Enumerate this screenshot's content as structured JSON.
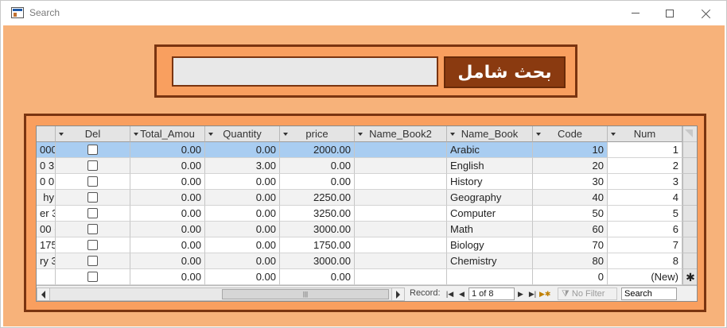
{
  "window": {
    "title": "Search"
  },
  "search": {
    "input_value": "",
    "button_label": "بحث شامل"
  },
  "grid": {
    "columns": [
      {
        "key": "cut",
        "label": ""
      },
      {
        "key": "del",
        "label": "Del"
      },
      {
        "key": "total",
        "label": "Total_Amou"
      },
      {
        "key": "qty",
        "label": "Quantity"
      },
      {
        "key": "price",
        "label": "price"
      },
      {
        "key": "name2",
        "label": "Name_Book2"
      },
      {
        "key": "name",
        "label": "Name_Book"
      },
      {
        "key": "code",
        "label": "Code"
      },
      {
        "key": "num",
        "label": "Num"
      }
    ],
    "rows": [
      {
        "cut": "000",
        "total": "0.00",
        "qty": "0.00",
        "price": "2000.00",
        "name2": "",
        "name": "Arabic",
        "code": "10",
        "num": "1"
      },
      {
        "cut": "0 3 (",
        "total": "0.00",
        "qty": "3.00",
        "price": "0.00",
        "name2": "",
        "name": "English",
        "code": "20",
        "num": "2"
      },
      {
        "cut": "0 0 (",
        "total": "0.00",
        "qty": "0.00",
        "price": "0.00",
        "name2": "",
        "name": "History",
        "code": "30",
        "num": "3"
      },
      {
        "cut": "hy",
        "total": "0.00",
        "qty": "0.00",
        "price": "2250.00",
        "name2": "",
        "name": "Geography",
        "code": "40",
        "num": "4"
      },
      {
        "cut": "er 3",
        "total": "0.00",
        "qty": "0.00",
        "price": "3250.00",
        "name2": "",
        "name": "Computer",
        "code": "50",
        "num": "5"
      },
      {
        "cut": "00 (",
        "total": "0.00",
        "qty": "0.00",
        "price": "3000.00",
        "name2": "",
        "name": "Math",
        "code": "60",
        "num": "6"
      },
      {
        "cut": "175",
        "total": "0.00",
        "qty": "0.00",
        "price": "1750.00",
        "name2": "",
        "name": "Biology",
        "code": "70",
        "num": "7"
      },
      {
        "cut": "ry 3",
        "total": "0.00",
        "qty": "0.00",
        "price": "3000.00",
        "name2": "",
        "name": "Chemistry",
        "code": "80",
        "num": "8"
      }
    ],
    "new_row": {
      "total": "0.00",
      "qty": "0.00",
      "price": "0.00",
      "code": "0",
      "num": "(New)",
      "marker": "✱"
    }
  },
  "nav": {
    "record_label": "Record:",
    "record_value": "1 of 8",
    "no_filter": "No Filter",
    "search_value": "Search"
  },
  "colors": {
    "form_bg": "#f7b27a",
    "panel_bg": "#f99f5f",
    "panel_border": "#7a3410",
    "button_bg": "#8a3a10",
    "selected_row": "#a9cdf1"
  }
}
